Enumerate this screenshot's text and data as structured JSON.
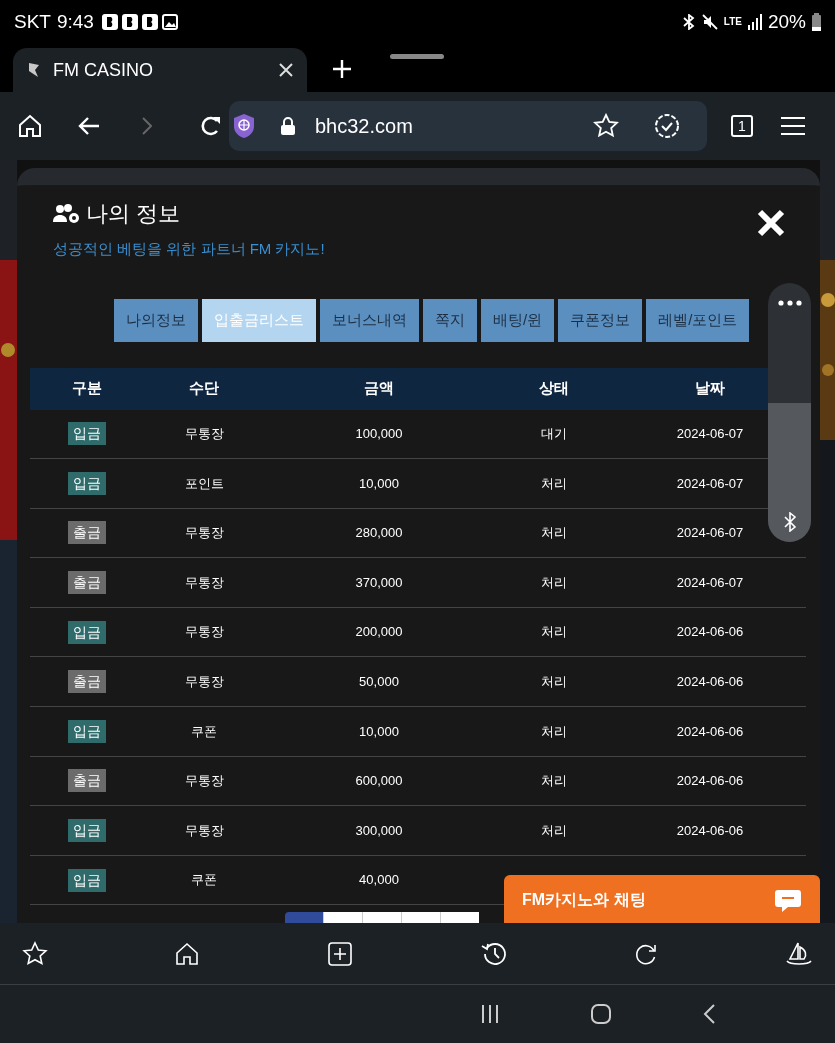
{
  "status_bar": {
    "carrier": "SKT",
    "time": "9:43",
    "network": "LTE",
    "battery": "20%"
  },
  "browser": {
    "tab_title": "FM CASINO",
    "url": "bhc32.com",
    "tab_count": "1"
  },
  "modal": {
    "title": "나의 정보",
    "subtitle": "성공적인 베팅을 위한 파트너 FM 카지노!"
  },
  "tabs": [
    {
      "label": "나의정보",
      "selected": false
    },
    {
      "label": "입출금리스트",
      "selected": true
    },
    {
      "label": "보너스내역",
      "selected": false
    },
    {
      "label": "쪽지",
      "selected": false
    },
    {
      "label": "배팅/윈",
      "selected": false
    },
    {
      "label": "쿠폰정보",
      "selected": false
    },
    {
      "label": "레벨/포인트",
      "selected": false
    }
  ],
  "table": {
    "columns": [
      "구분",
      "수단",
      "금액",
      "상태",
      "날짜"
    ],
    "rows": [
      {
        "kind": "deposit",
        "type": "입금",
        "method": "무통장",
        "amount": "100,000",
        "status": "대기",
        "date": "2024-06-07"
      },
      {
        "kind": "deposit",
        "type": "입금",
        "method": "포인트",
        "amount": "10,000",
        "status": "처리",
        "date": "2024-06-07"
      },
      {
        "kind": "withdraw",
        "type": "출금",
        "method": "무통장",
        "amount": "280,000",
        "status": "처리",
        "date": "2024-06-07"
      },
      {
        "kind": "withdraw",
        "type": "출금",
        "method": "무통장",
        "amount": "370,000",
        "status": "처리",
        "date": "2024-06-07"
      },
      {
        "kind": "deposit",
        "type": "입금",
        "method": "무통장",
        "amount": "200,000",
        "status": "처리",
        "date": "2024-06-06"
      },
      {
        "kind": "withdraw",
        "type": "출금",
        "method": "무통장",
        "amount": "50,000",
        "status": "처리",
        "date": "2024-06-06"
      },
      {
        "kind": "deposit",
        "type": "입금",
        "method": "쿠폰",
        "amount": "10,000",
        "status": "처리",
        "date": "2024-06-06"
      },
      {
        "kind": "withdraw",
        "type": "출금",
        "method": "무통장",
        "amount": "600,000",
        "status": "처리",
        "date": "2024-06-06"
      },
      {
        "kind": "deposit",
        "type": "입금",
        "method": "무통장",
        "amount": "300,000",
        "status": "처리",
        "date": "2024-06-06"
      },
      {
        "kind": "deposit",
        "type": "입금",
        "method": "쿠폰",
        "amount": "40,000"
      }
    ]
  },
  "chat": {
    "label": "FM카지노와 채팅"
  }
}
